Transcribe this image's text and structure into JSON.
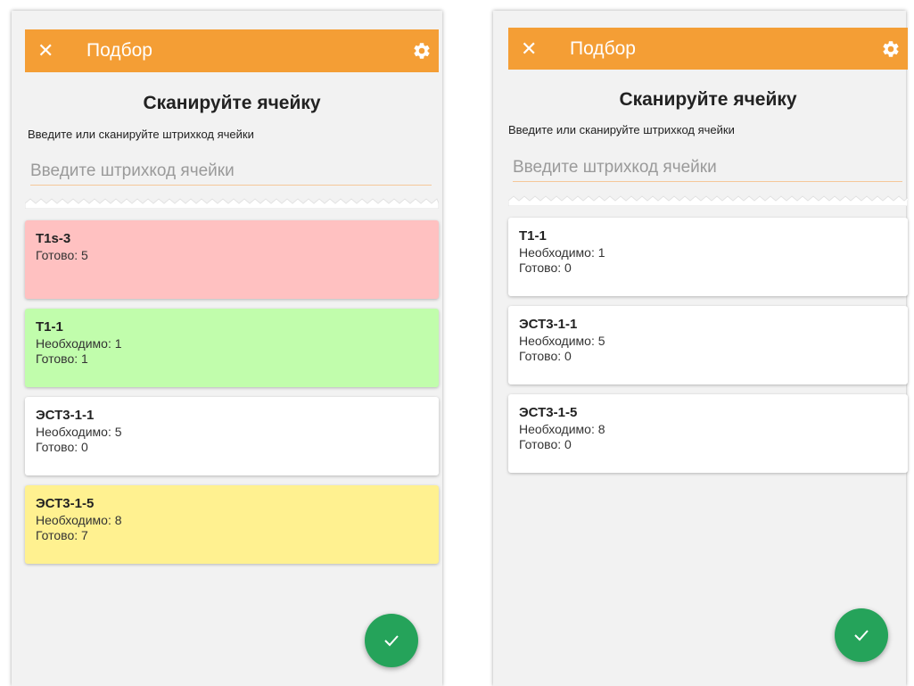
{
  "screens": [
    {
      "toolbar": {
        "close_glyph": "✕",
        "title": "Подбор",
        "settings_icon": "gear-icon"
      },
      "scan": {
        "title": "Сканируйте ячейку",
        "subtitle": "Введите или сканируйте штрихкод ячейки",
        "placeholder": "Введите штрихкод ячейки",
        "value": ""
      },
      "cells": [
        {
          "name": "T1s-3",
          "lines": [
            "Готово: 5"
          ],
          "status": "error",
          "color": "#ffc1c1"
        },
        {
          "name": "T1-1",
          "lines": [
            "Необходимо: 1",
            "Готово: 1"
          ],
          "status": "done",
          "color": "#c1fdac"
        },
        {
          "name": "ЭСТ3-1-1",
          "lines": [
            "Необходимо: 5",
            "Готово: 0"
          ],
          "status": "pending",
          "color": "#ffffff"
        },
        {
          "name": "ЭСТ3-1-5",
          "lines": [
            "Необходимо: 8",
            "Готово: 7"
          ],
          "status": "partial",
          "color": "#fff190"
        }
      ],
      "fab": {
        "icon": "check-icon",
        "color": "#25a35a"
      }
    },
    {
      "toolbar": {
        "close_glyph": "✕",
        "title": "Подбор",
        "settings_icon": "gear-icon"
      },
      "scan": {
        "title": "Сканируйте ячейку",
        "subtitle": "Введите или сканируйте штрихкод ячейки",
        "placeholder": "Введите штрихкод ячейки",
        "value": ""
      },
      "cells": [
        {
          "name": "T1-1",
          "lines": [
            "Необходимо: 1",
            "Готово: 0"
          ],
          "status": "pending",
          "color": "#ffffff"
        },
        {
          "name": "ЭСТ3-1-1",
          "lines": [
            "Необходимо: 5",
            "Готово: 0"
          ],
          "status": "pending",
          "color": "#ffffff"
        },
        {
          "name": "ЭСТ3-1-5",
          "lines": [
            "Необходимо: 8",
            "Готово: 0"
          ],
          "status": "pending",
          "color": "#ffffff"
        }
      ],
      "fab": {
        "icon": "check-icon",
        "color": "#25a35a"
      }
    }
  ],
  "colors": {
    "toolbar": "#f49e35",
    "background": "#f2f2f2"
  }
}
